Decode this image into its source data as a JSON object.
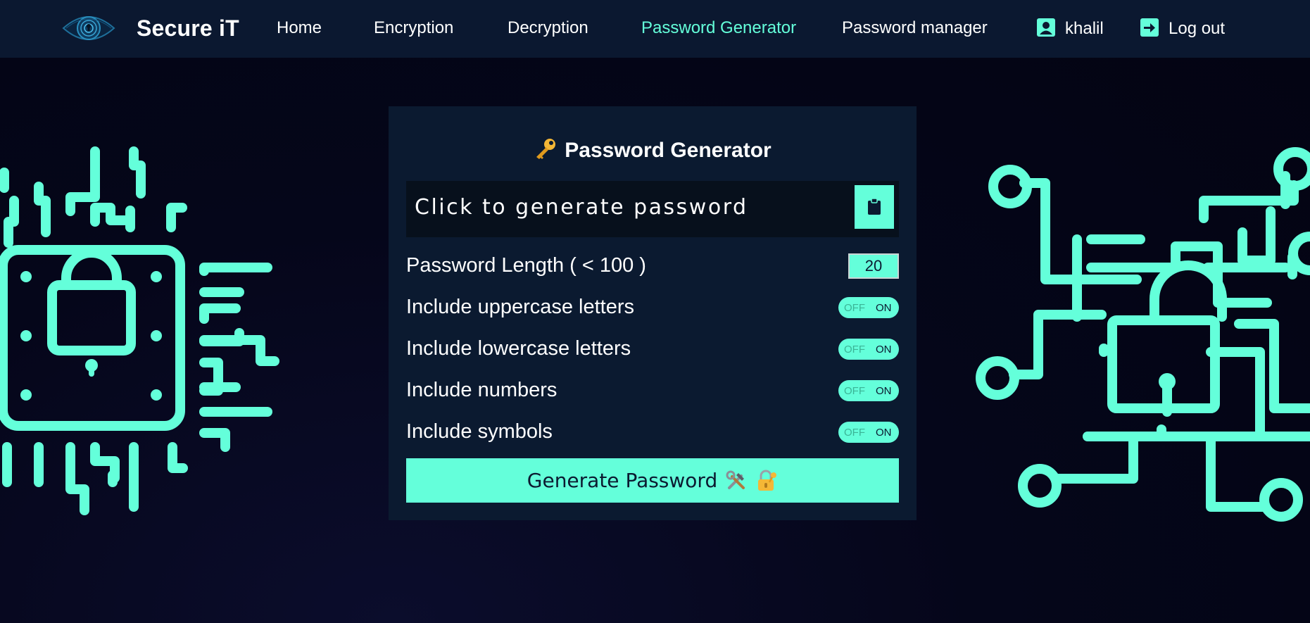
{
  "navbar": {
    "brand": "Secure iT",
    "links": [
      {
        "label": "Home"
      },
      {
        "label": "Encryption"
      },
      {
        "label": "Decryption"
      },
      {
        "label": "Password Generator"
      },
      {
        "label": "Password manager"
      }
    ],
    "user": "khalil",
    "logout": "Log out"
  },
  "card": {
    "title": "Password Generator",
    "title_icon": "key-icon",
    "password_placeholder": "Click to generate password",
    "copy_icon": "clipboard-icon",
    "length_label": "Password Length ( < 100 )",
    "length_value": "20",
    "options": [
      {
        "label": "Include uppercase letters",
        "off": "OFF",
        "on": "ON"
      },
      {
        "label": "Include lowercase letters",
        "off": "OFF",
        "on": "ON"
      },
      {
        "label": "Include numbers",
        "off": "OFF",
        "on": "ON"
      },
      {
        "label": "Include symbols",
        "off": "OFF",
        "on": "ON"
      }
    ],
    "generate_label": "Generate Password",
    "generate_icons": [
      "hammer-wrench-icon",
      "locked-with-key-icon"
    ]
  },
  "colors": {
    "accent": "#64ffda",
    "navbar_bg": "#0b1830",
    "card_bg": "#0b1a30",
    "page_bg": "#05061a"
  }
}
